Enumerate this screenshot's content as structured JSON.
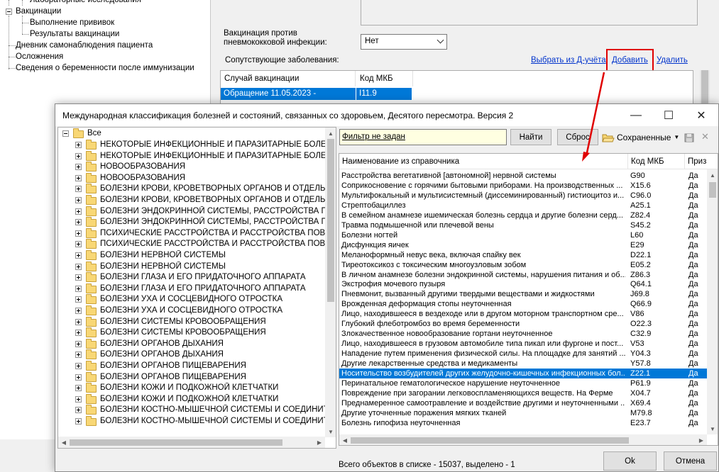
{
  "background": {
    "tree_items": [
      {
        "label": "Лабораторные исследования"
      },
      {
        "label": "Вакцинации"
      },
      {
        "label": "Выполнение прививок"
      },
      {
        "label": "Результаты вакцинации"
      },
      {
        "label": "Дневник самонаблюдения пациента"
      },
      {
        "label": "Осложнения"
      },
      {
        "label": "Сведения о беременности после иммунизации"
      }
    ],
    "pneumo_label": "Вакцинация против пневмококковой инфекции:",
    "pneumo_value": "Нет",
    "comorbidities_label": "Сопутствующие заболевания:",
    "links": {
      "select_from_d": "Выбрать из Д-учёта",
      "add": "Добавить",
      "delete": "Удалить"
    },
    "table": {
      "columns": [
        "Случай вакцинации",
        "Код МКБ"
      ],
      "row": [
        "Обращение 11.05.2023 -",
        "I11.9"
      ]
    }
  },
  "dialog": {
    "title": "Международная классификация болезней и состояний, связанных со здоровьем, Десятого пересмотра. Версия 2",
    "window_buttons": {
      "minimize": "—",
      "maximize": "☐",
      "close": "✕"
    },
    "tree_root": "Все",
    "tree_items": [
      "НЕКОТОРЫЕ ИНФЕКЦИОННЫЕ И ПАРАЗИТАРНЫЕ БОЛЕЗНИ",
      "НЕКОТОРЫЕ ИНФЕКЦИОННЫЕ И ПАРАЗИТАРНЫЕ БОЛЕЗНИ",
      "НОВООБРАЗОВАНИЯ",
      "НОВООБРАЗОВАНИЯ",
      "БОЛЕЗНИ КРОВИ, КРОВЕТВОРНЫХ ОРГАНОВ И ОТДЕЛЬНЫЕ НАРУШЕНИЯ",
      "БОЛЕЗНИ КРОВИ, КРОВЕТВОРНЫХ ОРГАНОВ И ОТДЕЛЬНЫЕ НАРУШЕНИЯ",
      "БОЛЕЗНИ ЭНДОКРИННОЙ СИСТЕМЫ, РАССТРОЙСТВА ПИТАНИЯ",
      "БОЛЕЗНИ ЭНДОКРИННОЙ СИСТЕМЫ, РАССТРОЙСТВА ПИТАНИЯ",
      "ПСИХИЧЕСКИЕ РАССТРОЙСТВА И РАССТРОЙСТВА ПОВЕДЕНИЯ",
      "ПСИХИЧЕСКИЕ РАССТРОЙСТВА И РАССТРОЙСТВА ПОВЕДЕНИЯ",
      "БОЛЕЗНИ НЕРВНОЙ СИСТЕМЫ",
      "БОЛЕЗНИ НЕРВНОЙ СИСТЕМЫ",
      "БОЛЕЗНИ ГЛАЗА И ЕГО ПРИДАТОЧНОГО АППАРАТА",
      "БОЛЕЗНИ ГЛАЗА И ЕГО ПРИДАТОЧНОГО АППАРАТА",
      "БОЛЕЗНИ УХА И СОСЦЕВИДНОГО ОТРОСТКА",
      "БОЛЕЗНИ УХА И СОСЦЕВИДНОГО ОТРОСТКА",
      "БОЛЕЗНИ СИСТЕМЫ КРОВООБРАЩЕНИЯ",
      "БОЛЕЗНИ СИСТЕМЫ КРОВООБРАЩЕНИЯ",
      "БОЛЕЗНИ ОРГАНОВ ДЫХАНИЯ",
      "БОЛЕЗНИ ОРГАНОВ ДЫХАНИЯ",
      "БОЛЕЗНИ ОРГАНОВ ПИЩЕВАРЕНИЯ",
      "БОЛЕЗНИ ОРГАНОВ ПИЩЕВАРЕНИЯ",
      "БОЛЕЗНИ КОЖИ И ПОДКОЖНОЙ КЛЕТЧАТКИ",
      "БОЛЕЗНИ КОЖИ И ПОДКОЖНОЙ КЛЕТЧАТКИ",
      "БОЛЕЗНИ КОСТНО-МЫШЕЧНОЙ СИСТЕМЫ И СОЕДИНИТЕЛЬНОЙ ТКАНИ",
      "БОЛЕЗНИ КОСТНО-МЫШЕЧНОЙ СИСТЕМЫ И СОЕДИНИТЕЛЬНОЙ ТКАНИ"
    ],
    "filter_text": "Фильтр не задан",
    "find_button": "Найти",
    "reset_button": "Сброс",
    "saved_label": "Сохраненные",
    "columns": [
      "Наименование из справочника",
      "Код МКБ",
      "Приз"
    ],
    "rows": [
      {
        "name": "Расстройства вегетативной [автономной] нервной системы",
        "code": "G90",
        "flag": "Да"
      },
      {
        "name": "Соприкосновение с горячими бытовыми приборами. На производственных ...",
        "code": "X15.6",
        "flag": "Да"
      },
      {
        "name": "Мультифокальный и мультисистемный (диссеминированный) гистиоцитоз и...",
        "code": "C96.0",
        "flag": "Да"
      },
      {
        "name": "Стрептобациллез",
        "code": "A25.1",
        "flag": "Да"
      },
      {
        "name": "В семейном анамнезе ишемическая болезнь сердца и другие болезни серд...",
        "code": "Z82.4",
        "flag": "Да"
      },
      {
        "name": "Травма подмышечной или плечевой вены",
        "code": "S45.2",
        "flag": "Да"
      },
      {
        "name": "Болезни ногтей",
        "code": "L60",
        "flag": "Да"
      },
      {
        "name": "Дисфункция яичек",
        "code": "E29",
        "flag": "Да"
      },
      {
        "name": "Меланоформный невус века, включая спайку век",
        "code": "D22.1",
        "flag": "Да"
      },
      {
        "name": "Тиреотоксикоз с токсическим многоузловым зобом",
        "code": "E05.2",
        "flag": "Да"
      },
      {
        "name": "В личном анамнезе болезни эндокринной системы, нарушения питания и об...",
        "code": "Z86.3",
        "flag": "Да"
      },
      {
        "name": "Экстрофия мочевого пузыря",
        "code": "Q64.1",
        "flag": "Да"
      },
      {
        "name": "Пневмонит, вызванный другими твердыми веществами и жидкостями",
        "code": "J69.8",
        "flag": "Да"
      },
      {
        "name": "Врожденная деформация стопы неуточненная",
        "code": "Q66.9",
        "flag": "Да"
      },
      {
        "name": "Лицо, находившееся в вездеходе или в другом моторном транспортном сре...",
        "code": "V86",
        "flag": "Да"
      },
      {
        "name": "Глубокий флеботромбоз во время беременности",
        "code": "O22.3",
        "flag": "Да"
      },
      {
        "name": "Злокачественное новообразование гортани неуточненное",
        "code": "C32.9",
        "flag": "Да"
      },
      {
        "name": "Лицо, находившееся в грузовом автомобиле типа пикап или фургоне и пост...",
        "code": "V53",
        "flag": "Да"
      },
      {
        "name": "Нападение путем применения физической силы. На площадке для занятий ...",
        "code": "Y04.3",
        "flag": "Да"
      },
      {
        "name": "Другие лекарственные средства и медикаменты",
        "code": "Y57.8",
        "flag": "Да"
      },
      {
        "name": "Носительство возбудителей других желудочно-кишечных инфекционных бол...",
        "code": "Z22.1",
        "flag": "Да",
        "selected": true
      },
      {
        "name": "Перинатальное гематологическое нарушение неуточненное",
        "code": "P61.9",
        "flag": "Да"
      },
      {
        "name": "Повреждение при загорании легковоспламеняющихся веществ. На Ферме",
        "code": "X04.7",
        "flag": "Да"
      },
      {
        "name": "Преднамеренное самоотравление и воздействие другими и неуточненными ...",
        "code": "X69.4",
        "flag": "Да"
      },
      {
        "name": "Другие уточненные поражения мягких тканей",
        "code": "M79.8",
        "flag": "Да"
      },
      {
        "name": "Болезнь гипофиза неуточненная",
        "code": "E23.7",
        "flag": "Да"
      }
    ],
    "status": "Всего объектов в списке - 15037, выделено - 1",
    "ok_button": "Ok",
    "cancel_button": "Отмена"
  },
  "colors": {
    "selection": "#0078d7",
    "annotation": "#e00000",
    "link": "#0033cc",
    "filter_bg": "#ffffe1"
  }
}
